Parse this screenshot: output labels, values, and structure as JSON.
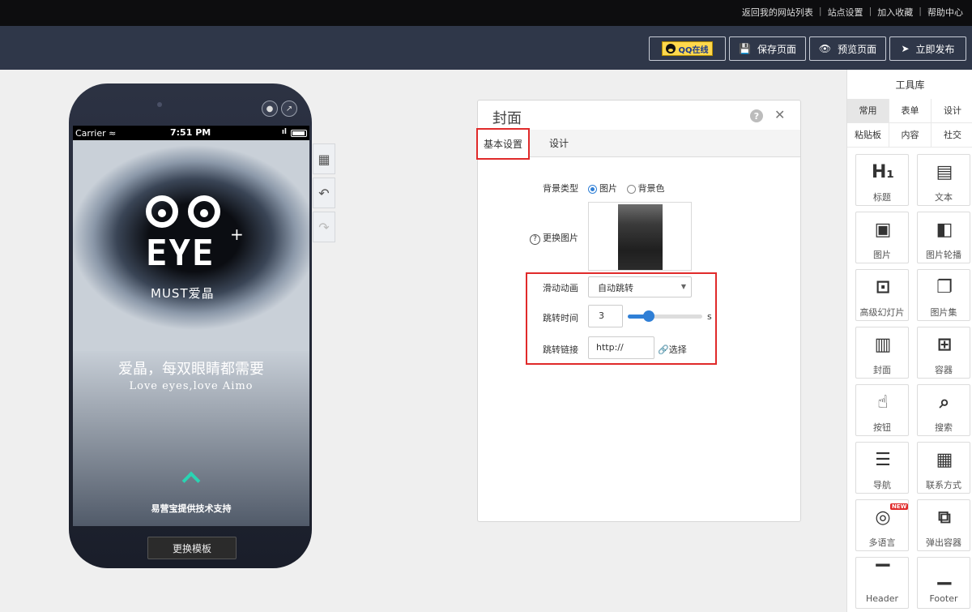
{
  "topbar": {
    "links": [
      "返回我的网站列表",
      "站点设置",
      "加入收藏",
      "帮助中心"
    ]
  },
  "toolbar": {
    "qq_label": "QQ在线",
    "save_label": "保存页面",
    "preview_label": "预览页面",
    "publish_label": "立即发布"
  },
  "phone": {
    "carrier": "Carrier",
    "time": "7:51 PM",
    "brand": "EYE",
    "brand_sub": "MUST爱晶",
    "slogan_cn": "爱晶，每双眼睛都需要",
    "slogan_en": "Love eyes,love Aimo",
    "tech_support": "易营宝提供技术支持",
    "change_template": "更换模板"
  },
  "panel": {
    "title": "封面",
    "tabs": [
      "基本设置",
      "设计"
    ],
    "bg_type_label": "背景类型",
    "bg_opt_image": "图片",
    "bg_opt_color": "背景色",
    "bg_selected": "图片",
    "change_image_label": "更换图片",
    "slide_anim_label": "滑动动画",
    "slide_anim_value": "自动跳转",
    "jump_time_label": "跳转时间",
    "jump_time_value": "3",
    "jump_time_unit": "s",
    "jump_time_slider_fraction": 0.28,
    "jump_link_label": "跳转链接",
    "jump_link_value": "http://",
    "jump_link_select": "选择"
  },
  "toolbox": {
    "title": "工具库",
    "tabs": [
      "常用",
      "表单",
      "设计",
      "粘贴板",
      "内容",
      "社交"
    ],
    "items": [
      {
        "label": "标题",
        "icon": "heading-icon"
      },
      {
        "label": "文本",
        "icon": "text-file-icon"
      },
      {
        "label": "图片",
        "icon": "image-icon"
      },
      {
        "label": "图片轮播",
        "icon": "carousel-icon"
      },
      {
        "label": "高级幻灯片",
        "icon": "slideshow-icon"
      },
      {
        "label": "图片集",
        "icon": "gallery-icon"
      },
      {
        "label": "封面",
        "icon": "cover-icon"
      },
      {
        "label": "容器",
        "icon": "container-icon"
      },
      {
        "label": "按钮",
        "icon": "pointer-icon"
      },
      {
        "label": "搜索",
        "icon": "search-icon"
      },
      {
        "label": "导航",
        "icon": "list-icon"
      },
      {
        "label": "联系方式",
        "icon": "contact-card-icon"
      },
      {
        "label": "多语言",
        "icon": "globe-icon",
        "badge": "NEW"
      },
      {
        "label": "弹出容器",
        "icon": "popup-icon"
      },
      {
        "label": "Header",
        "icon": "header-icon"
      },
      {
        "label": "Footer",
        "icon": "footer-icon"
      }
    ]
  },
  "colors": {
    "topbar": "#0d0d0f",
    "toolbar": "#2f3749",
    "highlight": "#e02a2a",
    "accent": "#2f7fd6",
    "teal": "#2ad4b3"
  }
}
